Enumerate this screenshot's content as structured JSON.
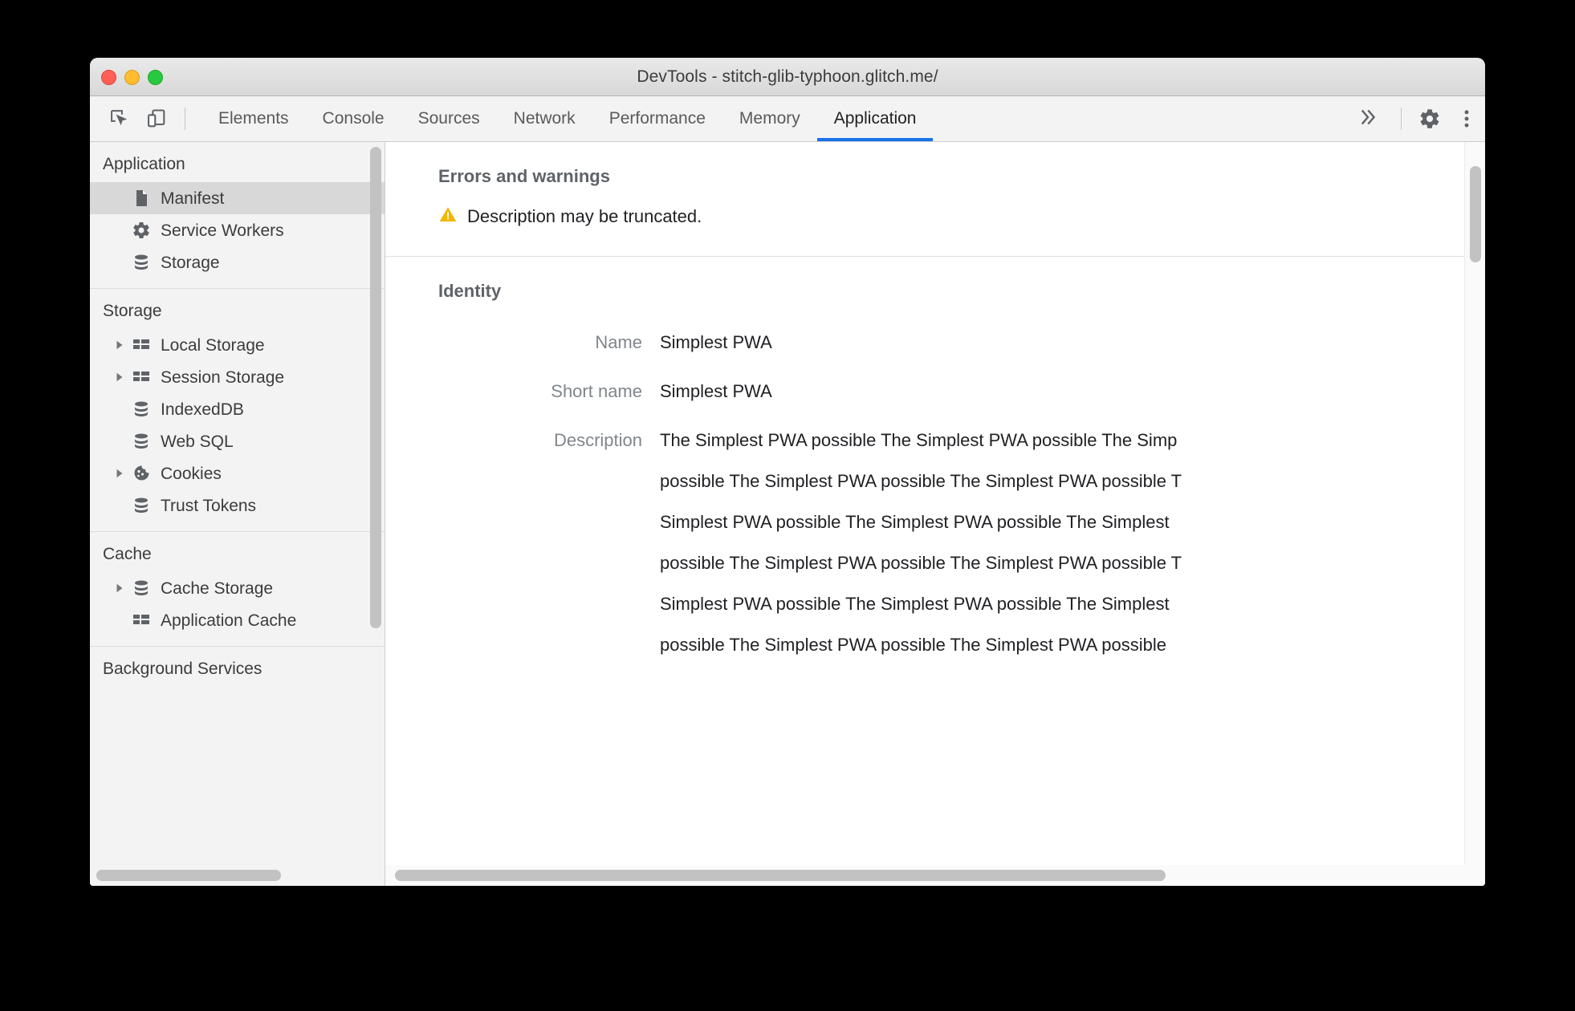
{
  "window": {
    "title": "DevTools - stitch-glib-typhoon.glitch.me/",
    "traffic_lights": [
      "close",
      "minimize",
      "maximize"
    ]
  },
  "toolbar": {
    "inspect_icon": "inspect-element-icon",
    "device_icon": "device-toolbar-icon",
    "tabs": [
      {
        "label": "Elements",
        "active": false
      },
      {
        "label": "Console",
        "active": false
      },
      {
        "label": "Sources",
        "active": false
      },
      {
        "label": "Network",
        "active": false
      },
      {
        "label": "Performance",
        "active": false
      },
      {
        "label": "Memory",
        "active": false
      },
      {
        "label": "Application",
        "active": true
      }
    ],
    "more_tabs_label": "»",
    "settings_icon": "gear-icon",
    "menu_icon": "kebab-menu-icon",
    "active_tab_underline_color": "#1a73e8"
  },
  "sidebar": {
    "groups": [
      {
        "title": "Application",
        "items": [
          {
            "label": "Manifest",
            "icon": "document-icon",
            "twisty": false,
            "selected": true
          },
          {
            "label": "Service Workers",
            "icon": "gear-icon",
            "twisty": false,
            "selected": false
          },
          {
            "label": "Storage",
            "icon": "database-icon",
            "twisty": false,
            "selected": false
          }
        ]
      },
      {
        "title": "Storage",
        "items": [
          {
            "label": "Local Storage",
            "icon": "table-icon",
            "twisty": true,
            "selected": false
          },
          {
            "label": "Session Storage",
            "icon": "table-icon",
            "twisty": true,
            "selected": false
          },
          {
            "label": "IndexedDB",
            "icon": "database-icon",
            "twisty": false,
            "selected": false
          },
          {
            "label": "Web SQL",
            "icon": "database-icon",
            "twisty": false,
            "selected": false
          },
          {
            "label": "Cookies",
            "icon": "cookie-icon",
            "twisty": true,
            "selected": false
          },
          {
            "label": "Trust Tokens",
            "icon": "database-icon",
            "twisty": false,
            "selected": false
          }
        ]
      },
      {
        "title": "Cache",
        "items": [
          {
            "label": "Cache Storage",
            "icon": "database-icon",
            "twisty": true,
            "selected": false
          },
          {
            "label": "Application Cache",
            "icon": "table-icon",
            "twisty": false,
            "selected": false
          }
        ]
      },
      {
        "title": "Background Services",
        "items": []
      }
    ]
  },
  "main": {
    "errors_section": {
      "title": "Errors and warnings",
      "warning_icon": "warning-triangle-icon",
      "warning_color": "#f2b600",
      "warning_text": "Description may be truncated."
    },
    "identity_section": {
      "title": "Identity",
      "fields": [
        {
          "label": "Name",
          "value": "Simplest PWA"
        },
        {
          "label": "Short name",
          "value": "Simplest PWA"
        }
      ],
      "description_label": "Description",
      "description_lines": [
        "The Simplest PWA possible The Simplest PWA possible The Simp",
        "possible The Simplest PWA possible The Simplest PWA possible T",
        "Simplest PWA possible The Simplest PWA possible The Simplest",
        "possible The Simplest PWA possible The Simplest PWA possible T",
        "Simplest PWA possible The Simplest PWA possible The Simplest",
        "possible The Simplest PWA possible The Simplest PWA possible"
      ]
    }
  }
}
